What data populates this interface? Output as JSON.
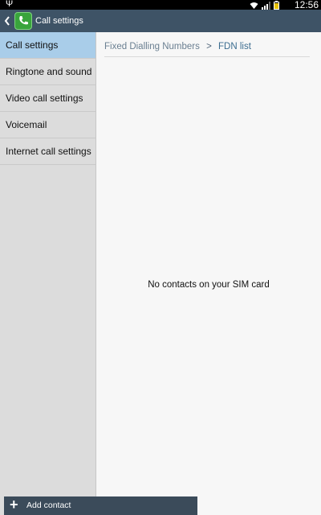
{
  "status_bar": {
    "usb_icon": "usb-icon",
    "status_icons": [
      "wifi-icon",
      "signal-icon",
      "battery-icon"
    ],
    "time": "12:56"
  },
  "action_bar": {
    "title": "Call settings",
    "back_icon": "chevron-left-icon",
    "app_icon": "phone-icon",
    "color": "#3e5366"
  },
  "sidebar": {
    "items": [
      {
        "label": "Call settings",
        "active": true
      },
      {
        "label": "Ringtone and sound",
        "active": false
      },
      {
        "label": "Video call settings",
        "active": false
      },
      {
        "label": "Voicemail",
        "active": false
      },
      {
        "label": "Internet call settings",
        "active": false
      }
    ],
    "active_color": "#a9cde9"
  },
  "breadcrumb": {
    "parent": "Fixed Dialling Numbers",
    "separator": ">",
    "current": "FDN list"
  },
  "main": {
    "empty_message": "No contacts on your SIM card"
  },
  "bottom_action": {
    "icon": "plus-icon",
    "label": "Add contact"
  }
}
